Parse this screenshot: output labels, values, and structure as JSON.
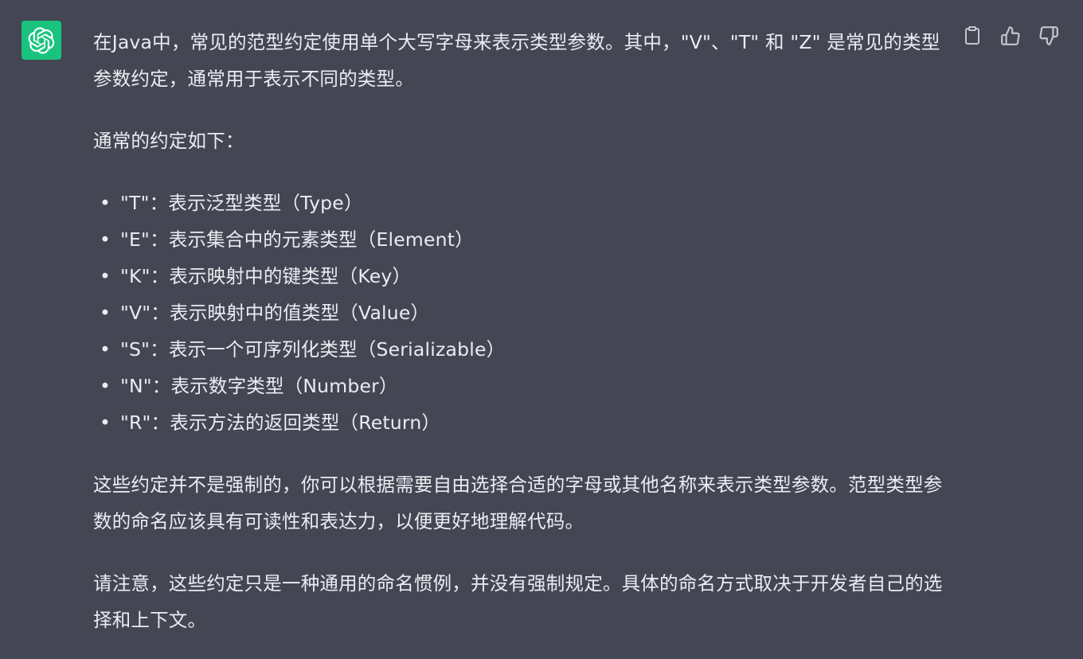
{
  "message": {
    "intro": "在Java中，常见的范型约定使用单个大写字母来表示类型参数。其中，\"V\"、\"T\" 和 \"Z\" 是常见的类型参数约定，通常用于表示不同的类型。",
    "conventions_heading": "通常的约定如下：",
    "bullets": [
      "\"T\"：表示泛型类型（Type）",
      "\"E\"：表示集合中的元素类型（Element）",
      "\"K\"：表示映射中的键类型（Key）",
      "\"V\"：表示映射中的值类型（Value）",
      "\"S\"：表示一个可序列化类型（Serializable）",
      "\"N\"：表示数字类型（Number）",
      "\"R\"：表示方法的返回类型（Return）"
    ],
    "paragraph_flexibility": "这些约定并不是强制的，你可以根据需要自由选择合适的字母或其他名称来表示类型参数。范型类型参数的命名应该具有可读性和表达力，以便更好地理解代码。",
    "paragraph_note": "请注意，这些约定只是一种通用的命名惯例，并没有强制规定。具体的命名方式取决于开发者自己的选择和上下文。"
  },
  "icons": {
    "avatar": "openai-logo-icon",
    "copy": "clipboard-icon",
    "like": "thumbs-up-icon",
    "dislike": "thumbs-down-icon"
  },
  "colors": {
    "background": "#444654",
    "text": "#ececf1",
    "avatar_bg": "#19c37d",
    "icon": "#c5c5d2"
  }
}
